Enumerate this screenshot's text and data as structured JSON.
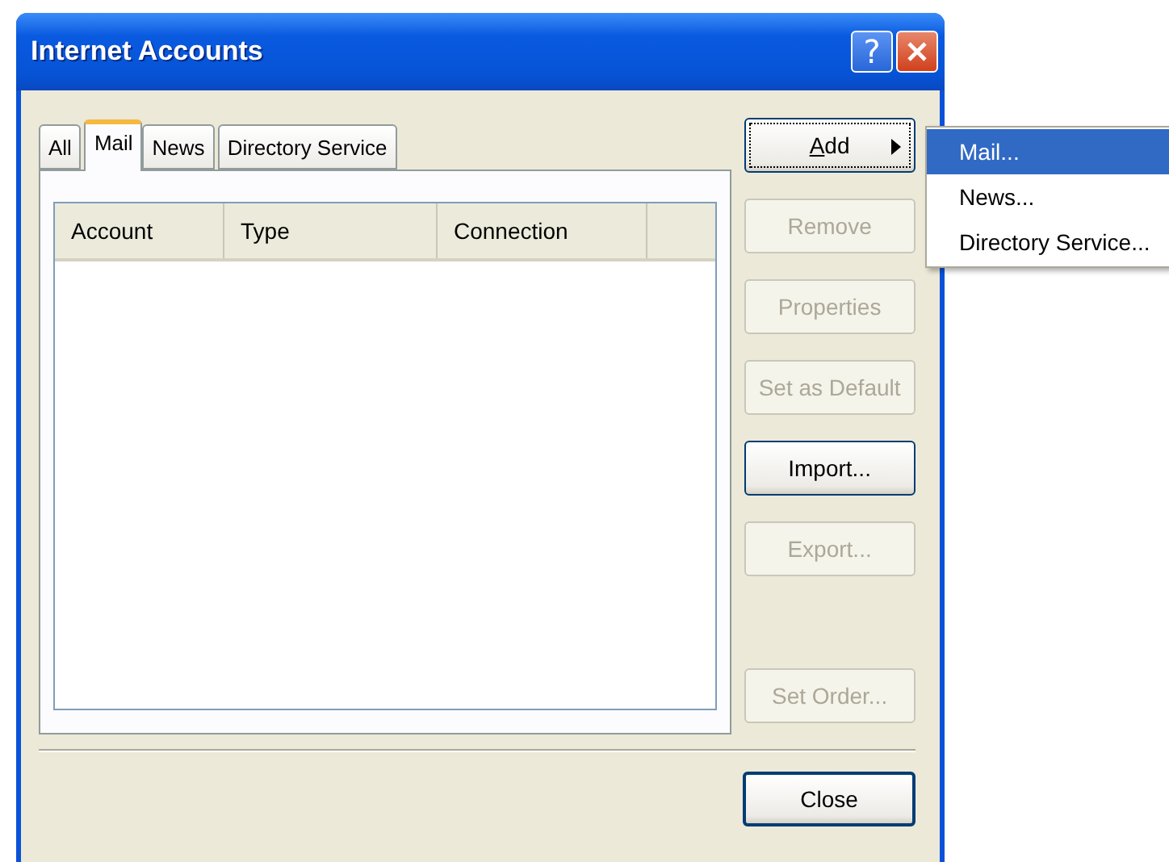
{
  "window": {
    "title": "Internet Accounts",
    "help_button": "?"
  },
  "tabs": [
    {
      "label": "All",
      "selected": false
    },
    {
      "label": "Mail",
      "selected": true
    },
    {
      "label": "News",
      "selected": false
    },
    {
      "label": "Directory Service",
      "selected": false
    }
  ],
  "table": {
    "columns": [
      "Account",
      "Type",
      "Connection"
    ]
  },
  "buttons": [
    {
      "label": "Add",
      "disabled": false,
      "focused": true,
      "kind": "submenu"
    },
    {
      "label": "Remove",
      "disabled": true,
      "focused": false,
      "kind": "plain"
    },
    {
      "label": "Properties",
      "disabled": true,
      "focused": false,
      "kind": "plain"
    },
    {
      "label": "Set as Default",
      "disabled": true,
      "focused": false,
      "kind": "plain"
    },
    {
      "label": "Import...",
      "disabled": false,
      "focused": false,
      "kind": "plain"
    },
    {
      "label": "Export...",
      "disabled": true,
      "focused": false,
      "kind": "plain"
    },
    {
      "label": "Set Order...",
      "disabled": true,
      "focused": false,
      "kind": "spaced"
    }
  ],
  "close_button": "Close",
  "add_menu": [
    {
      "label": "Mail...",
      "selected": true
    },
    {
      "label": "News...",
      "selected": false
    },
    {
      "label": "Directory Service...",
      "selected": false
    }
  ]
}
